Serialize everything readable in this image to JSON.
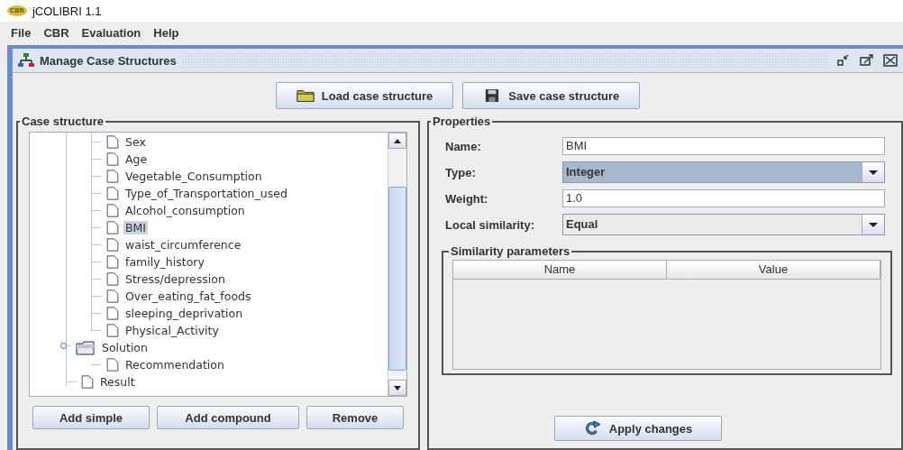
{
  "app": {
    "title": "jCOLIBRI 1.1",
    "logo_text": "CBR"
  },
  "menu": [
    {
      "label": "File"
    },
    {
      "label": "CBR"
    },
    {
      "label": "Evaluation"
    },
    {
      "label": "Help"
    }
  ],
  "frame": {
    "title": "Manage Case Structures"
  },
  "toolbar": [
    {
      "label": "Load case structure",
      "kind": "load"
    },
    {
      "label": "Save case structure",
      "kind": "save"
    }
  ],
  "case_structure": {
    "title": "Case structure",
    "scrolled_children": [
      {
        "label": "Sex",
        "kind": "leaf",
        "selected": false
      },
      {
        "label": "Age",
        "kind": "leaf",
        "selected": false
      },
      {
        "label": "Vegetable_Consumption",
        "kind": "leaf",
        "selected": false
      },
      {
        "label": "Type_of_Transportation_used",
        "kind": "leaf",
        "selected": false
      },
      {
        "label": "Alcohol_consumption",
        "kind": "leaf",
        "selected": false
      },
      {
        "label": "BMI",
        "kind": "leaf",
        "selected": true
      },
      {
        "label": "waist_circumference",
        "kind": "leaf",
        "selected": false
      },
      {
        "label": "family_history",
        "kind": "leaf",
        "selected": false
      },
      {
        "label": "Stress/depression",
        "kind": "leaf",
        "selected": false
      },
      {
        "label": "Over_eating_fat_foods",
        "kind": "leaf",
        "selected": false
      },
      {
        "label": "sleeping_deprivation",
        "kind": "leaf",
        "selected": false
      },
      {
        "label": "Physical_Activity",
        "kind": "leaf",
        "selected": false
      }
    ],
    "items": [
      {
        "label": "Solution",
        "kind": "folder",
        "selected": false,
        "expanded": true,
        "children": [
          {
            "label": "Recommendation",
            "kind": "leaf",
            "selected": false
          }
        ]
      },
      {
        "label": "Result",
        "kind": "leaf",
        "selected": false
      }
    ],
    "buttons": [
      {
        "label": "Add simple"
      },
      {
        "label": "Add compound"
      },
      {
        "label": "Remove"
      }
    ]
  },
  "properties": {
    "title": "Properties",
    "fields": [
      {
        "label": "Name:",
        "value": "BMI",
        "kind": "text"
      },
      {
        "label": "Type:",
        "value": "Integer",
        "kind": "combo",
        "selected": true
      },
      {
        "label": "Weight:",
        "value": "1.0",
        "kind": "text"
      },
      {
        "label": "Local similarity:",
        "value": "Equal",
        "kind": "combo",
        "selected": false
      }
    ],
    "similarity": {
      "title": "Similarity parameters",
      "columns": [
        "Name",
        "Value"
      ]
    },
    "apply_button": "Apply changes"
  }
}
